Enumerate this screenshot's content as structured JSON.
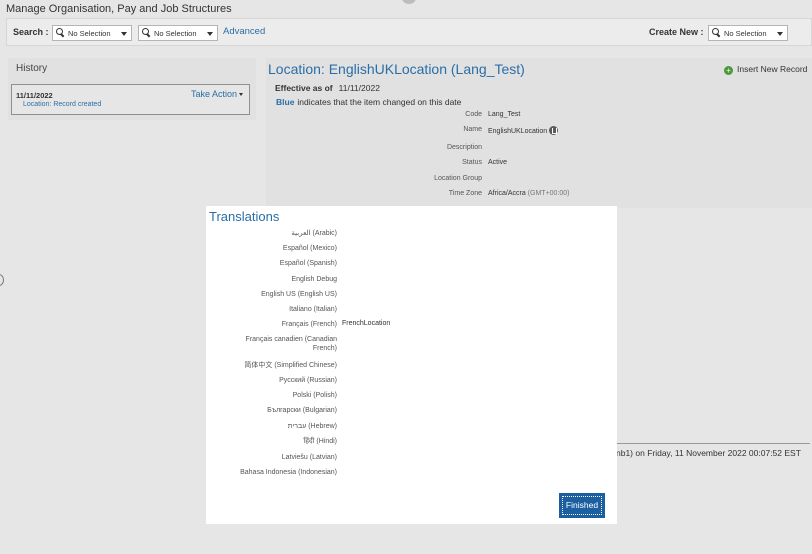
{
  "app": {
    "title": "Manage Organisation, Pay and Job Structures"
  },
  "toolbar": {
    "search_label": "Search :",
    "search_select_1": "No Selection",
    "search_select_2": "No Selection",
    "advanced_label": "Advanced",
    "create_new_label": "Create New :",
    "create_new_select": "No Selection"
  },
  "history": {
    "title": "History",
    "entry_date": "11/11/2022",
    "entry_desc": "Location: Record created",
    "take_action_label": "Take Action"
  },
  "detail": {
    "title": "Location: EnglishUKLocation (Lang_Test)",
    "insert_new_label": "Insert New Record",
    "effective_label": "Effective as of",
    "effective_date": "11/11/2022",
    "changed_note_blue": "Blue",
    "changed_note_text": "indicates that the item changed on this date",
    "fields": [
      {
        "label": "Code",
        "value": "Lang_Test"
      },
      {
        "label": "Name",
        "value": "EnglishUKLocation"
      },
      {
        "label": "Description",
        "value": ""
      },
      {
        "label": "Status",
        "value": "Active"
      },
      {
        "label": "Location Group",
        "value": ""
      },
      {
        "label": "Time Zone",
        "value": "Africa/Accra",
        "extra": "(GMT+00:00)"
      }
    ]
  },
  "footer": {
    "text": "nb1) on Friday, 11 November 2022 00:07:52 EST"
  },
  "modal": {
    "title": "Translations",
    "rows": [
      {
        "lang": "العربية (Arabic)",
        "value": ""
      },
      {
        "lang": "Español (Mexico)",
        "value": ""
      },
      {
        "lang": "Español (Spanish)",
        "value": ""
      },
      {
        "lang": "English Debug",
        "value": ""
      },
      {
        "lang": "English US (English US)",
        "value": ""
      },
      {
        "lang": "Italiano (Italian)",
        "value": ""
      },
      {
        "lang": "Français (French)",
        "value": "FrenchLocation"
      },
      {
        "lang": "Français canadien (Canadian French)",
        "value": ""
      },
      {
        "lang": "简体中文 (Simplified Chinese)",
        "value": ""
      },
      {
        "lang": "Русский (Russian)",
        "value": ""
      },
      {
        "lang": "Polski (Polish)",
        "value": ""
      },
      {
        "lang": "Български (Bulgarian)",
        "value": ""
      },
      {
        "lang": "עברית (Hebrew)",
        "value": ""
      },
      {
        "lang": "हिंदी (Hindi)",
        "value": ""
      },
      {
        "lang": "Latviešu (Latvian)",
        "value": ""
      },
      {
        "lang": "Bahasa Indonesia (Indonesian)",
        "value": ""
      }
    ],
    "finished_label": "Finished"
  }
}
